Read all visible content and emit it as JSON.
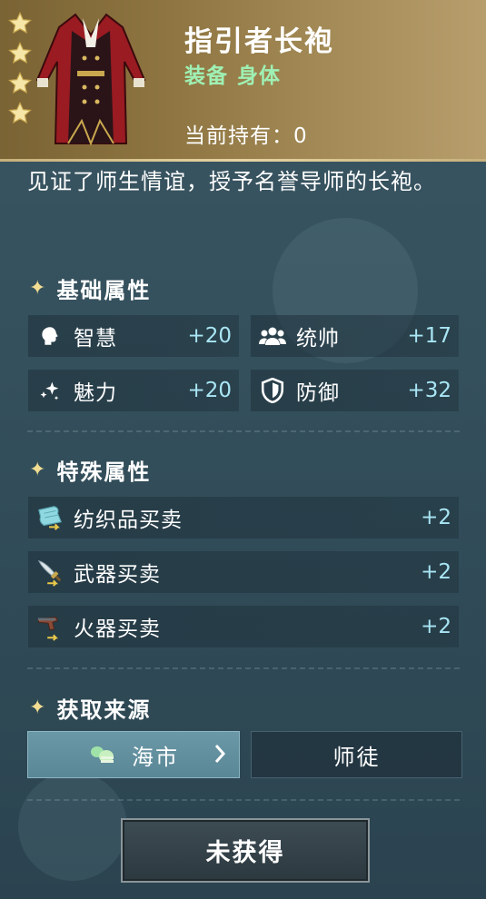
{
  "item": {
    "name": "指引者长袍",
    "type_tags": [
      "装备",
      "身体"
    ],
    "owned_label": "当前持有：",
    "owned_count": "0",
    "rarity_stars": 4,
    "description": "见证了师生情谊，授予名誉导师的长袍。"
  },
  "base_attributes": {
    "title": "基础属性",
    "items": [
      {
        "icon": "brain-icon",
        "label": "智慧",
        "value": "+20"
      },
      {
        "icon": "group-icon",
        "label": "统帅",
        "value": "+17"
      },
      {
        "icon": "sparkle-icon",
        "label": "魅力",
        "value": "+20"
      },
      {
        "icon": "shield-icon",
        "label": "防御",
        "value": "+32"
      }
    ]
  },
  "special_attributes": {
    "title": "特殊属性",
    "items": [
      {
        "icon": "cloth-trade-icon",
        "label": "纺织品买卖",
        "value": "+2"
      },
      {
        "icon": "sword-trade-icon",
        "label": "武器买卖",
        "value": "+2"
      },
      {
        "icon": "gun-trade-icon",
        "label": "火器买卖",
        "value": "+2"
      }
    ]
  },
  "sources": {
    "title": "获取来源",
    "items": [
      {
        "icon": "coins-icon",
        "label": "海市",
        "active": true
      },
      {
        "label": "师徒",
        "active": false
      }
    ]
  },
  "status_button": {
    "label": "未获得"
  },
  "colors": {
    "header_gold": "#8e7541",
    "type_green": "#9ff0b4",
    "value_blue": "#a9e6f5",
    "panel_bg": "#34505c",
    "star_gold": "#f2dd93"
  }
}
